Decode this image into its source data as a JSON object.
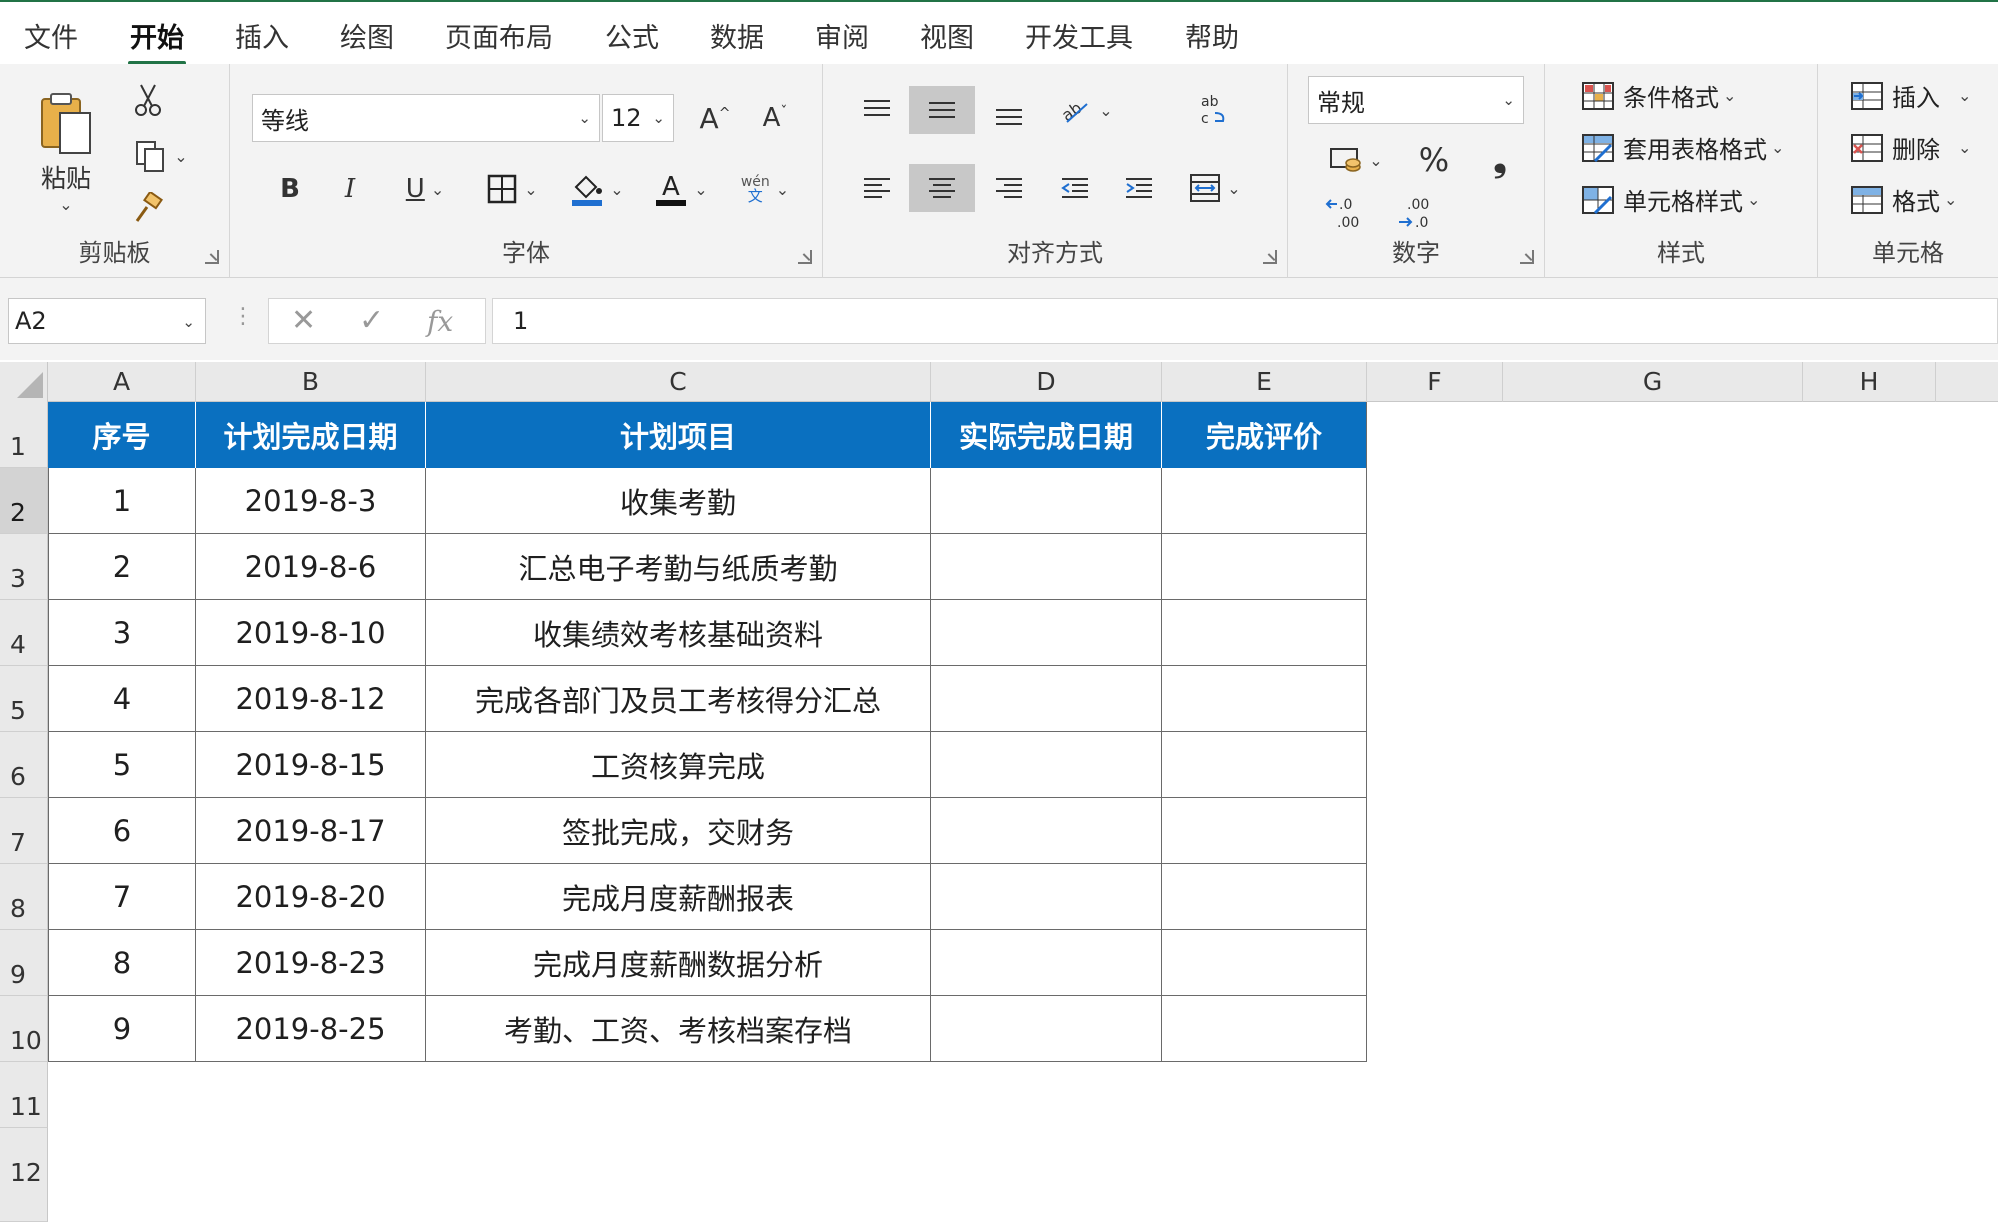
{
  "tabs": [
    "文件",
    "开始",
    "插入",
    "绘图",
    "页面布局",
    "公式",
    "数据",
    "审阅",
    "视图",
    "开发工具",
    "帮助"
  ],
  "active_tab": "开始",
  "ribbon": {
    "clipboard": {
      "paste_label": "粘贴",
      "group_label": "剪贴板"
    },
    "font": {
      "font_name": "等线",
      "font_size": "12",
      "group_label": "字体",
      "phonetic_label": "wén",
      "phonetic_sub": "文"
    },
    "alignment": {
      "group_label": "对齐方式"
    },
    "number": {
      "format": "常规",
      "group_label": "数字",
      "percent": "%",
      "comma": "❟",
      "inc_decimal": ".0\n.00",
      "dec_decimal": ".00\n→.0"
    },
    "styles": {
      "conditional": "条件格式",
      "table_format": "套用表格格式",
      "cell_styles": "单元格样式",
      "group_label": "样式"
    },
    "cells": {
      "insert": "插入",
      "delete": "删除",
      "format": "格式",
      "group_label": "单元格"
    }
  },
  "formula_bar": {
    "name_box": "A2",
    "formula": "1",
    "fx": "fx"
  },
  "columns": [
    "A",
    "B",
    "C",
    "D",
    "E",
    "F",
    "G",
    "H"
  ],
  "rows": [
    "1",
    "2",
    "3",
    "4",
    "5",
    "6",
    "7",
    "8",
    "9",
    "10",
    "11",
    "12"
  ],
  "table": {
    "headers": [
      "序号",
      "计划完成日期",
      "计划项目",
      "实际完成日期",
      "完成评价"
    ],
    "rows": [
      [
        "1",
        "2019-8-3",
        "收集考勤",
        "",
        ""
      ],
      [
        "2",
        "2019-8-6",
        "汇总电子考勤与纸质考勤",
        "",
        ""
      ],
      [
        "3",
        "2019-8-10",
        "收集绩效考核基础资料",
        "",
        ""
      ],
      [
        "4",
        "2019-8-12",
        "完成各部门及员工考核得分汇总",
        "",
        ""
      ],
      [
        "5",
        "2019-8-15",
        "工资核算完成",
        "",
        ""
      ],
      [
        "6",
        "2019-8-17",
        "签批完成，交财务",
        "",
        ""
      ],
      [
        "7",
        "2019-8-20",
        "完成月度薪酬报表",
        "",
        ""
      ],
      [
        "8",
        "2019-8-23",
        "完成月度薪酬数据分析",
        "",
        ""
      ],
      [
        "9",
        "2019-8-25",
        "考勤、工资、考核档案存档",
        "",
        ""
      ]
    ]
  },
  "colors": {
    "accent_green": "#217346",
    "header_blue": "#0a70c0",
    "fill_color_bar": "#1f6fd0",
    "font_color_bar": "#111111"
  }
}
